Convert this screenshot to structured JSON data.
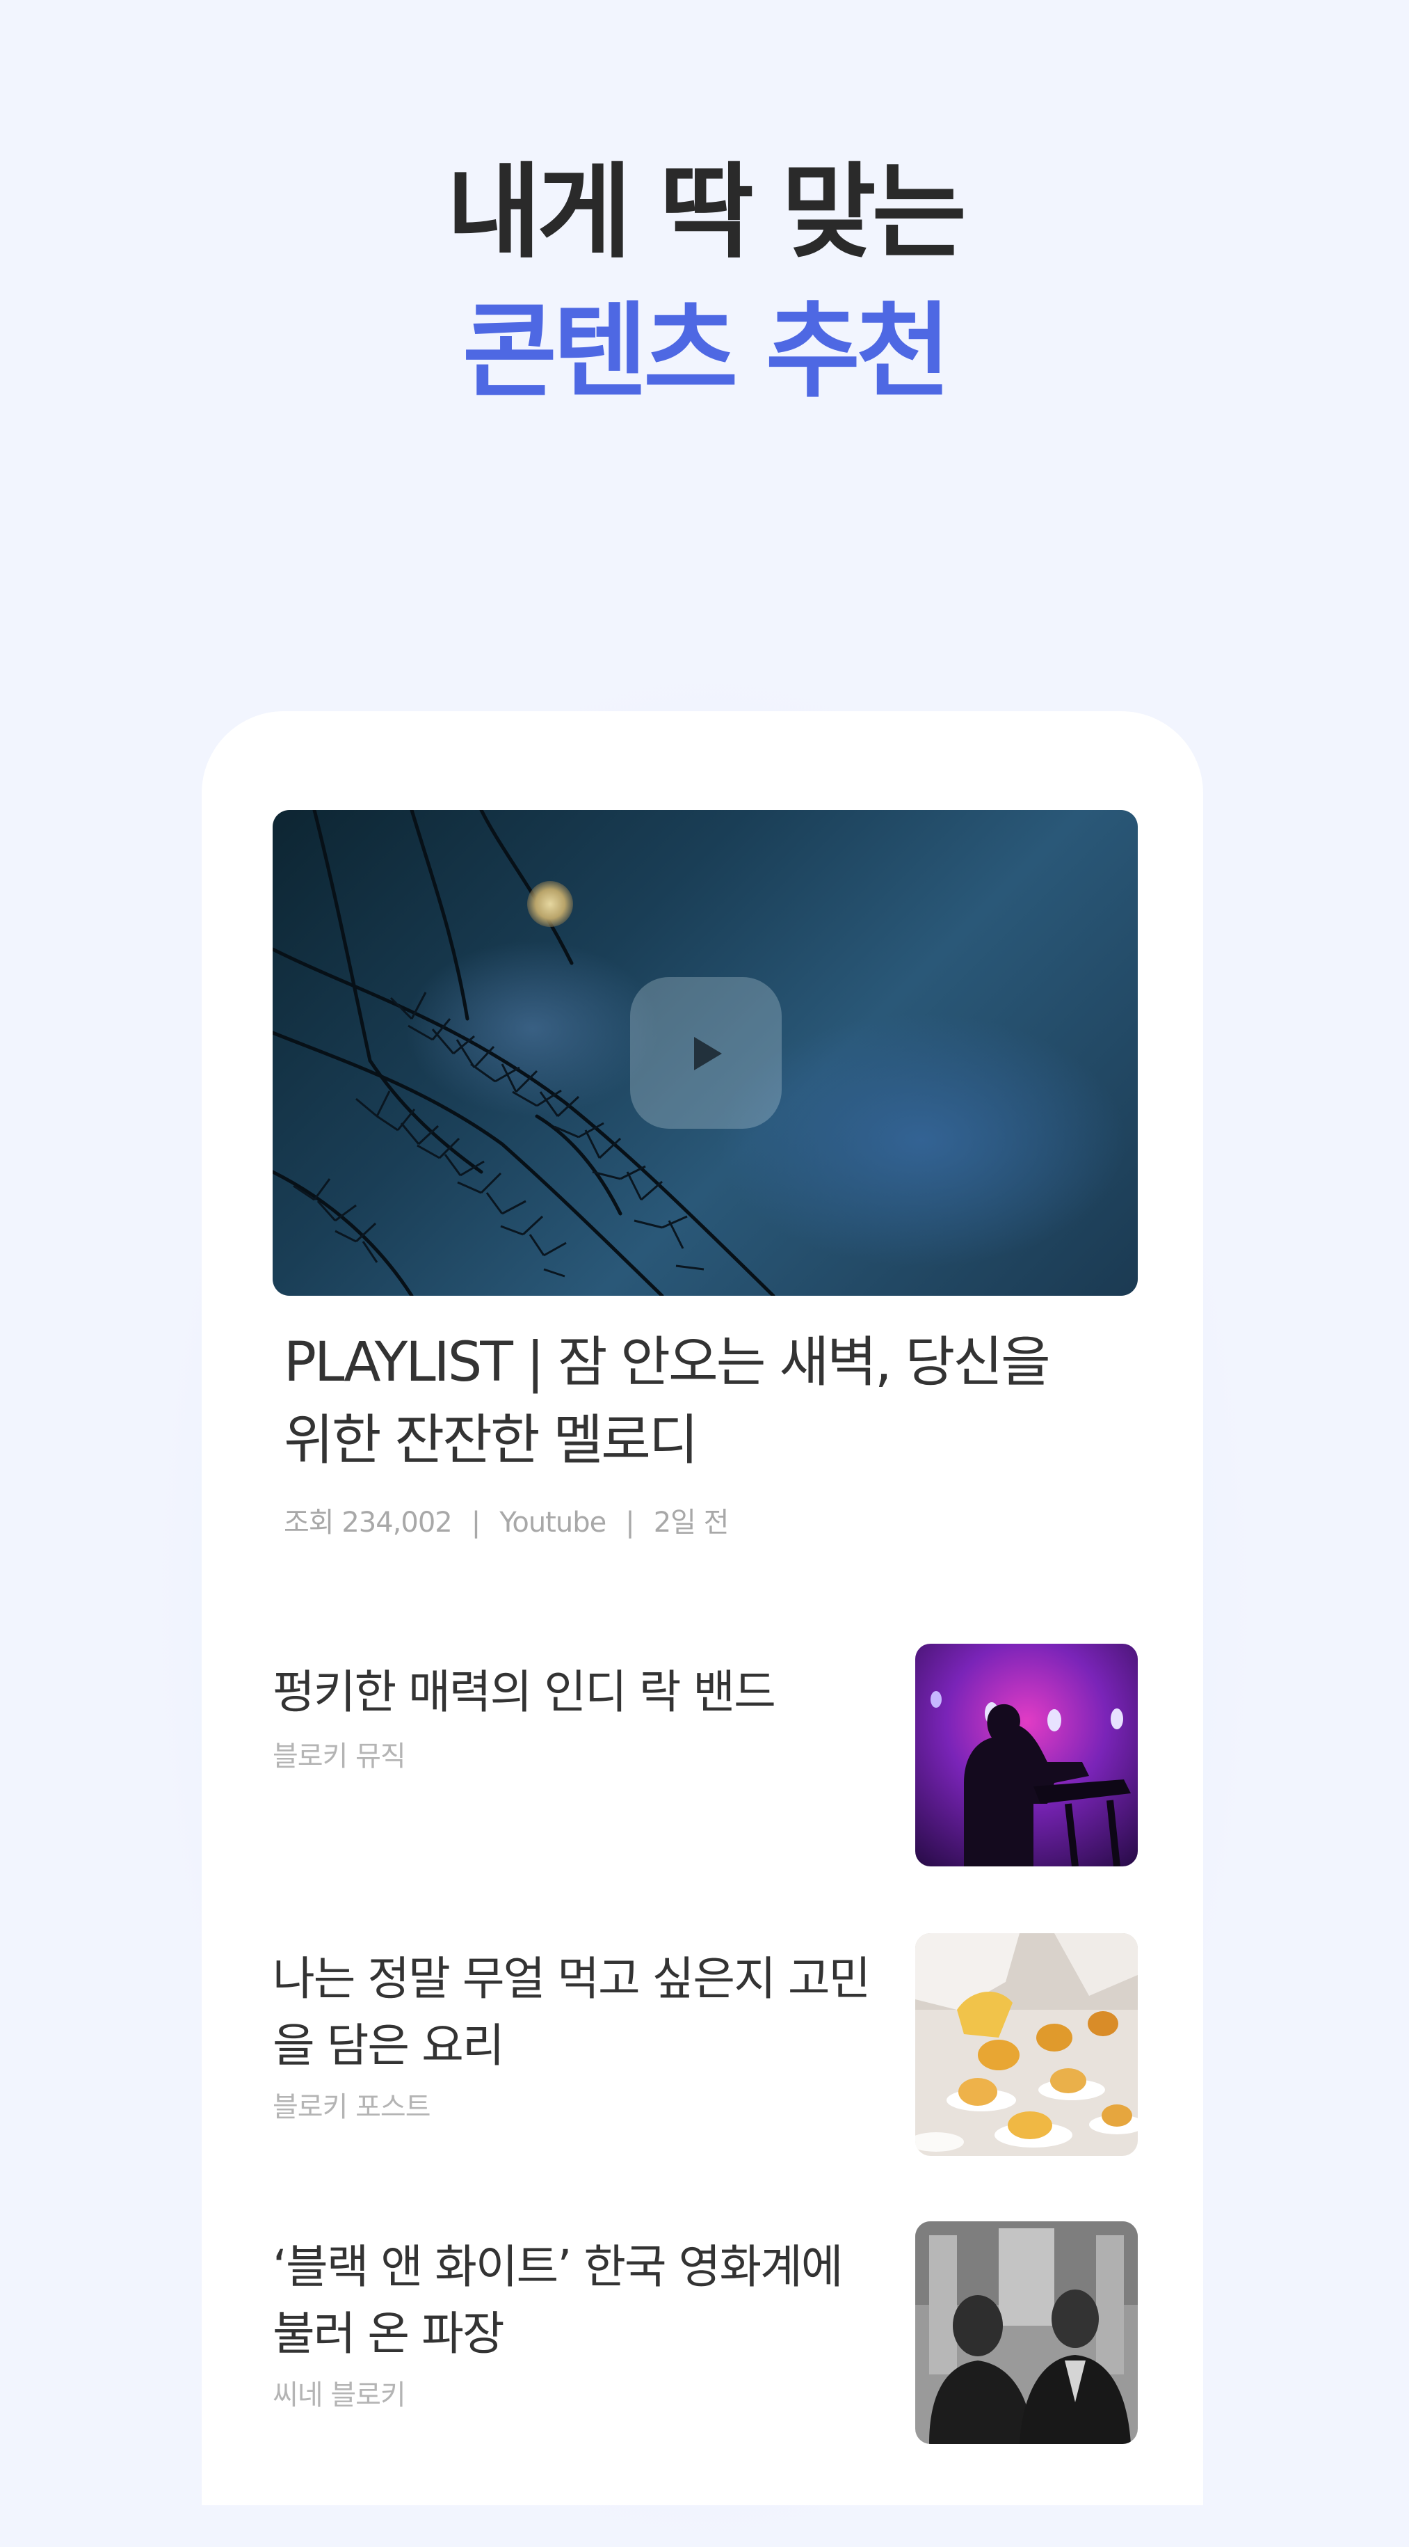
{
  "hero": {
    "line1": "내게 딱 맞는",
    "line2": "콘텐츠 추천"
  },
  "featured": {
    "title_line1": "PLAYLIST | 잠 안오는 새벽, 당신을",
    "title_line2": "위한 잔잔한 멜로디",
    "views": "조회 234,002",
    "source": "Youtube",
    "time": "2일 전",
    "separator": "|",
    "play_icon": "play-icon"
  },
  "items": [
    {
      "title_line1": "펑키한 매력의 인디 락 밴드",
      "title_line2": "",
      "source": "블로키 뮤직"
    },
    {
      "title_line1": "나는 정말 무얼 먹고 싶은지 고민",
      "title_line2": "을 담은 요리",
      "source": "블로키 포스트"
    },
    {
      "title_line1": "‘블랙 앤 화이트’ 한국 영화계에",
      "title_line2": "불러 온 파장",
      "source": "씨네 블로키"
    }
  ],
  "colors": {
    "background": "#f2f5fe",
    "accent": "#4e68e3",
    "title_text": "#2a2a2a",
    "meta_text": "#a8a8a8"
  }
}
